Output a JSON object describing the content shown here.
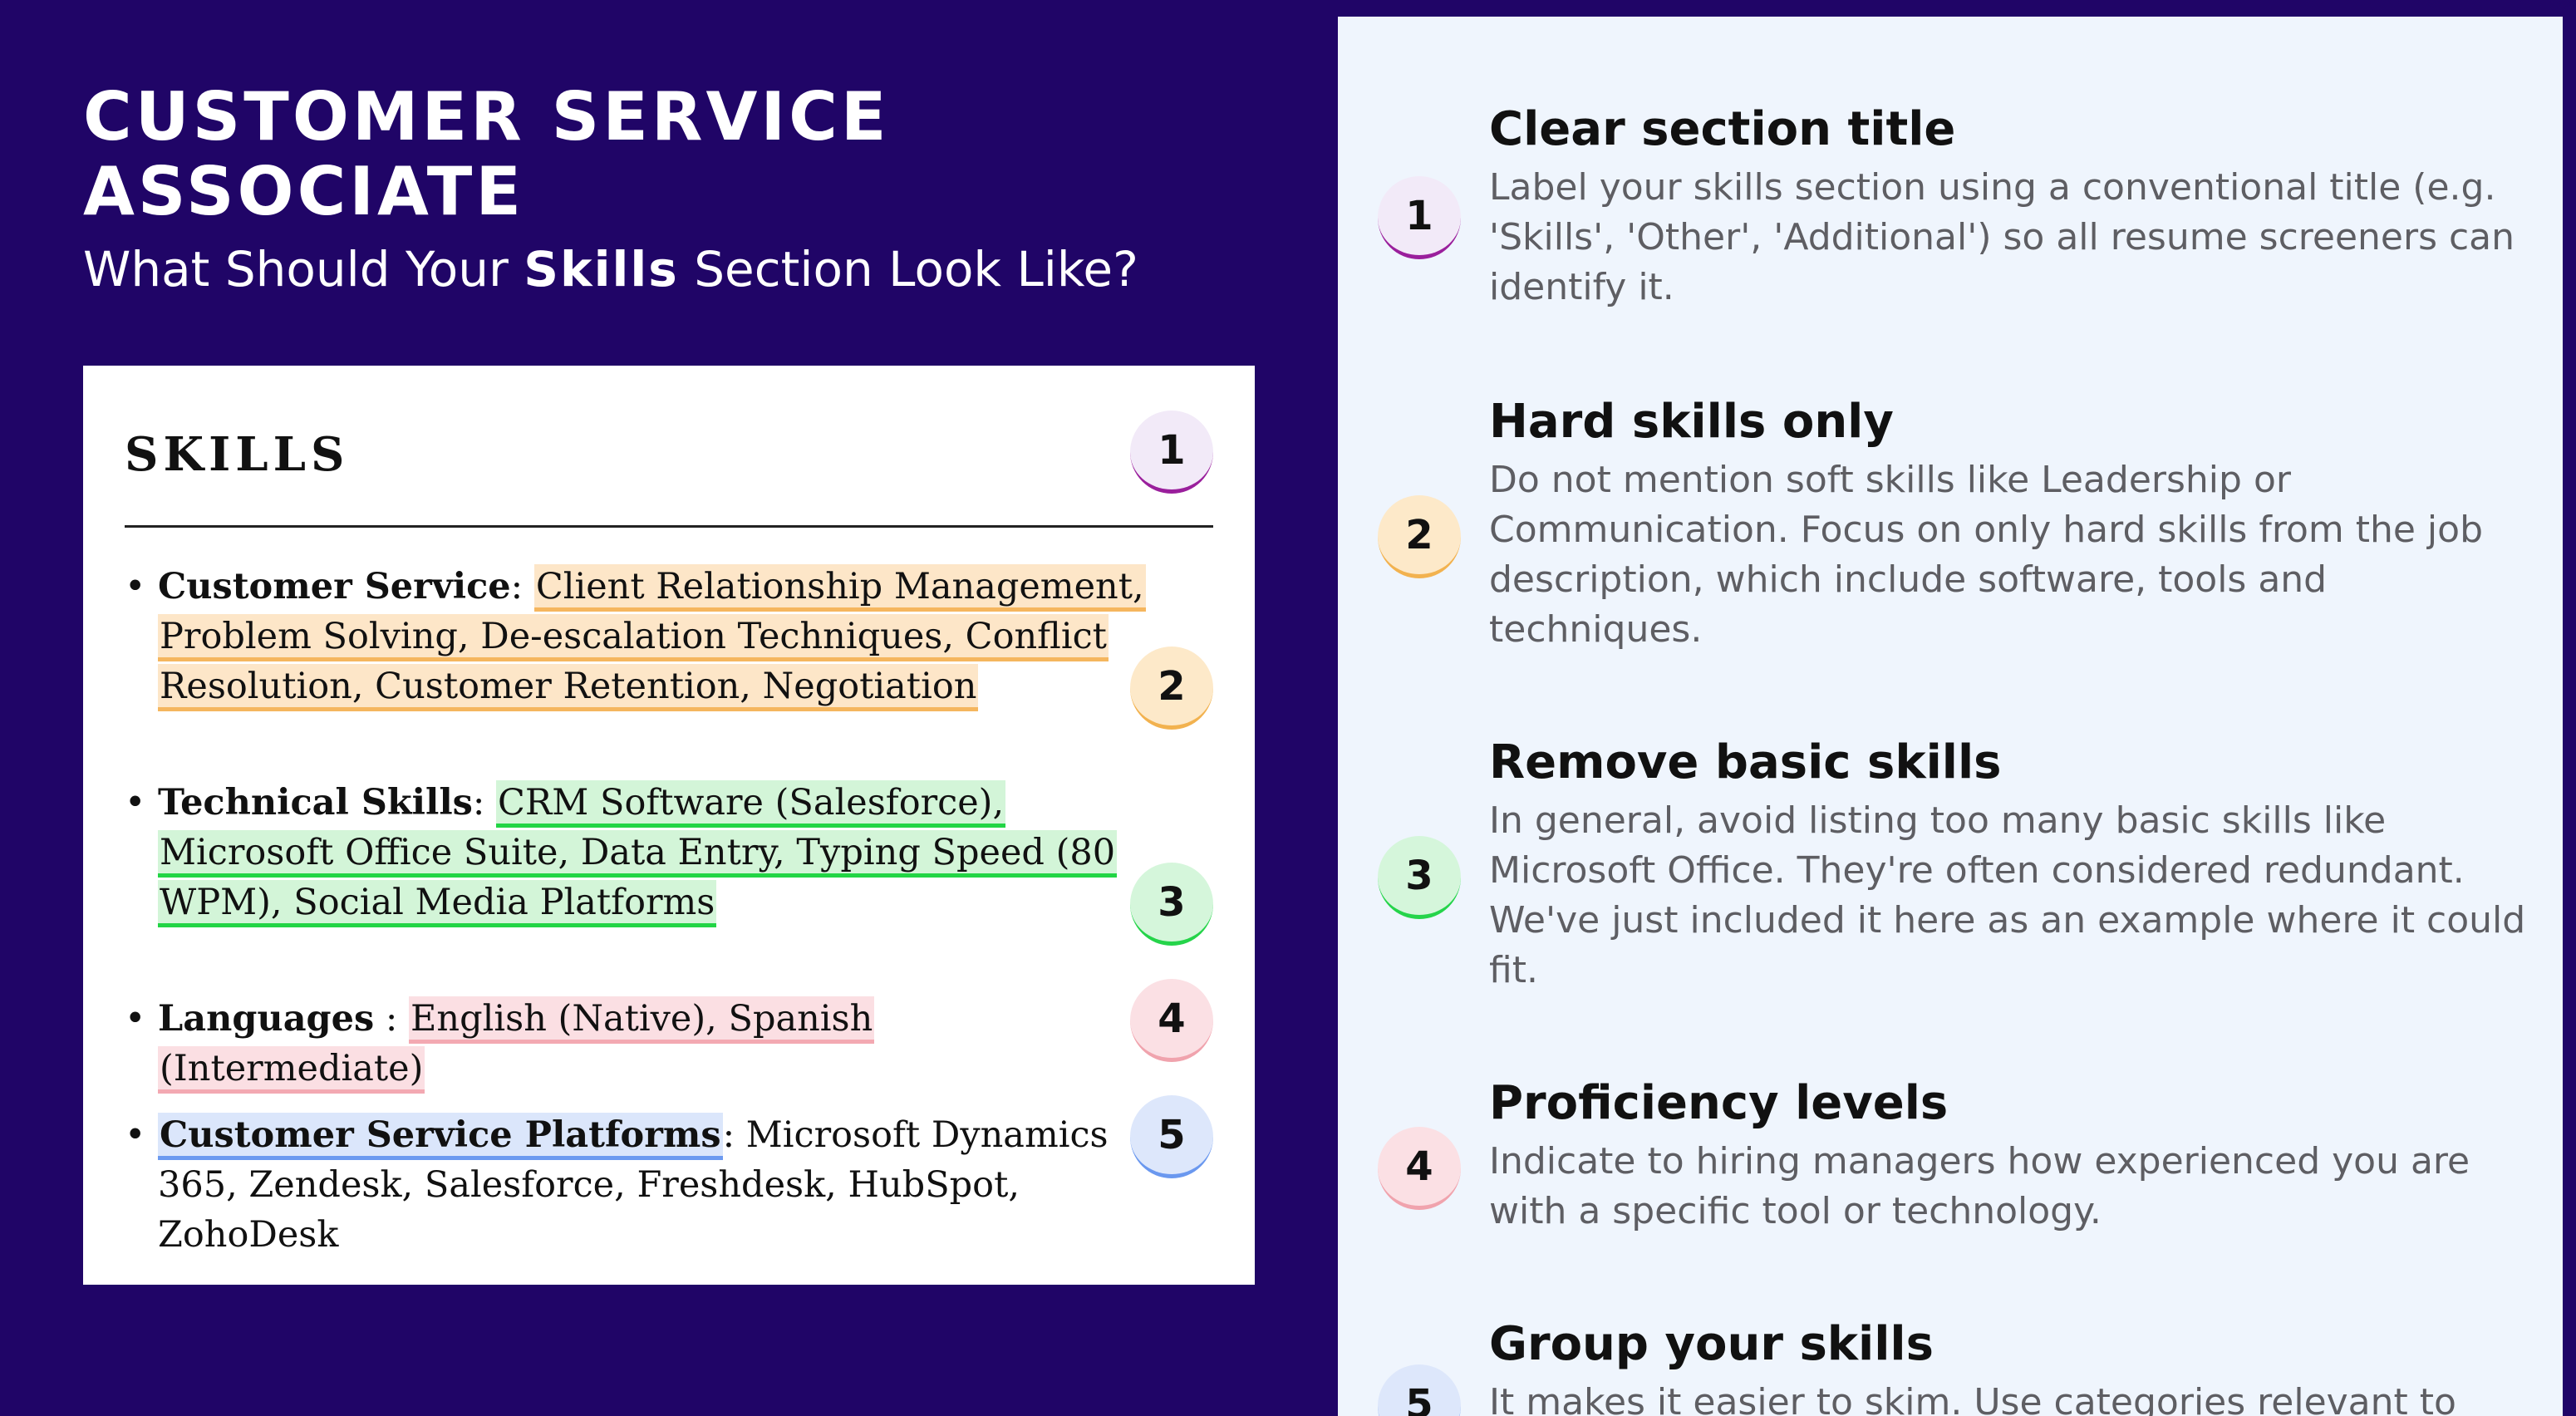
{
  "header": {
    "job_title": "CUSTOMER SERVICE ASSOCIATE",
    "subtitle_before": "What Should Your ",
    "subtitle_bold": "Skills",
    "subtitle_after": " Section Look Like?"
  },
  "resume": {
    "section_heading": "SKILLS",
    "bullet": "•",
    "items": [
      {
        "category": "Customer Service",
        "separator": ": ",
        "skills": "Client Relationship Management, Problem Solving, De-escalation Techniques, Conflict Resolution, Customer Retention, Negotiation",
        "badge": "2"
      },
      {
        "category": "Technical Skills",
        "separator": ": ",
        "skills": "CRM Software (Salesforce), Microsoft Office Suite, Data Entry, Typing Speed (80 WPM), Social Media Platforms",
        "badge": "3"
      },
      {
        "category": "Languages",
        "separator": " : ",
        "skills": "English (Native), Spanish (Intermediate)",
        "badge": "4"
      },
      {
        "category": "Customer Service Platforms",
        "separator": ": ",
        "skills": "Microsoft Dynamics 365, Zendesk, Salesforce, Freshdesk, HubSpot, ZohoDesk",
        "badge": "5"
      }
    ],
    "heading_badge": "1"
  },
  "tips": [
    {
      "number": "1",
      "title": "Clear section title",
      "description": "Label your skills section using a conventional title (e.g. 'Skills', 'Other', 'Additional') so all resume screeners can identify it."
    },
    {
      "number": "2",
      "title": "Hard skills only",
      "description": "Do not mention soft skills like Leadership or Communication. Focus on only hard skills from the job description, which include software, tools and techniques."
    },
    {
      "number": "3",
      "title": "Remove basic skills",
      "description": "In general, avoid listing too many basic skills like Microsoft Office. They're often considered redundant. We've just included it here as an example where it could fit."
    },
    {
      "number": "4",
      "title": "Proficiency levels",
      "description": "Indicate to hiring managers how experienced you are with a specific tool or technology."
    },
    {
      "number": "5",
      "title": "Group your skills",
      "description": "It makes it easier to skim. Use categories relevant to your"
    }
  ],
  "colors": {
    "background": "#200567",
    "panel": "#eff5fd",
    "badge_1_accent": "#9a1f9c",
    "badge_2_accent": "#f2b24f",
    "badge_3_accent": "#25d44a",
    "badge_4_accent": "#f0a3ad",
    "badge_5_accent": "#6a98ef"
  }
}
